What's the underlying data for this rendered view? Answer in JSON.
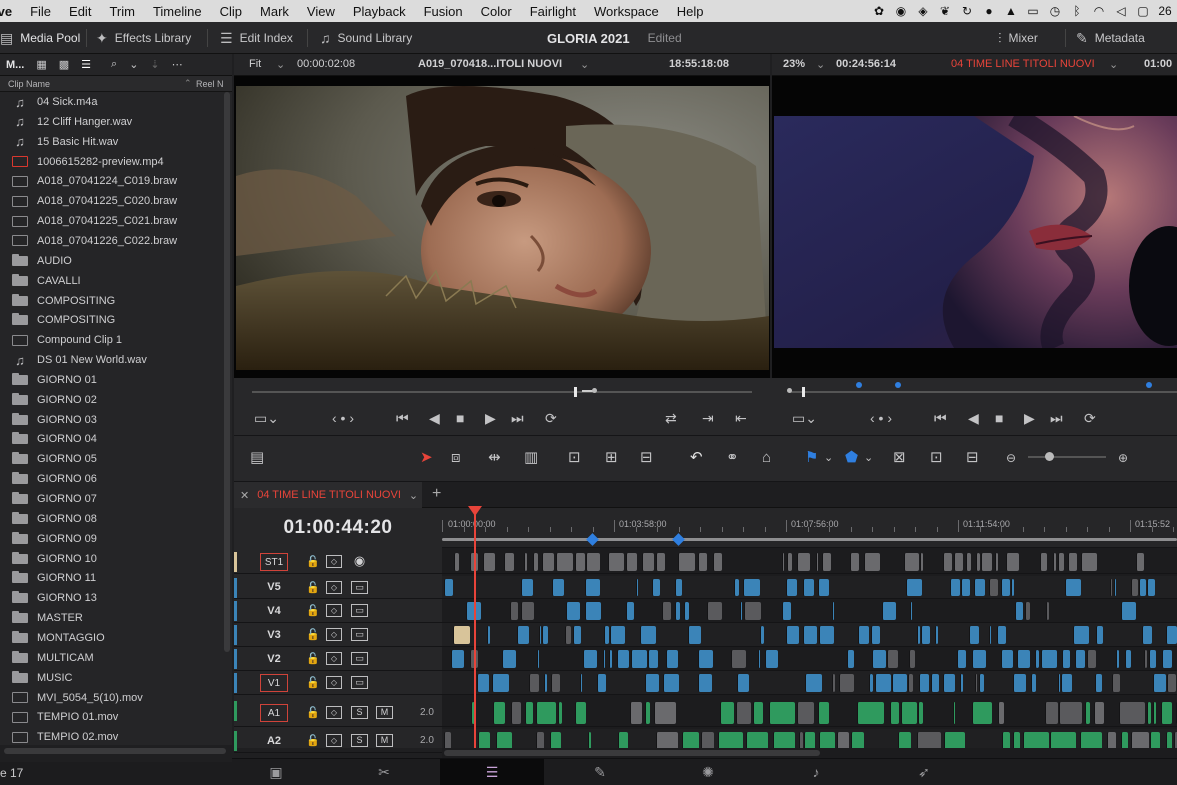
{
  "menubar": {
    "app": "ive",
    "items": [
      "File",
      "Edit",
      "Trim",
      "Timeline",
      "Clip",
      "Mark",
      "View",
      "Playback",
      "Fusion",
      "Color",
      "Fairlight",
      "Workspace",
      "Help"
    ],
    "clock": "26"
  },
  "toolbar": {
    "media_pool": "Media Pool",
    "effects_library": "Effects Library",
    "edit_index": "Edit Index",
    "sound_library": "Sound Library",
    "project_name": "GLORIA 2021",
    "project_status": "Edited",
    "mixer": "Mixer",
    "metadata": "Metadata"
  },
  "media_pool": {
    "view_label": "M...",
    "col_clip_name": "Clip Name",
    "col_reel_name": "Reel N",
    "items": [
      {
        "name": "04 Sick.m4a",
        "type": "audio"
      },
      {
        "name": "12 Cliff Hanger.wav",
        "type": "audio"
      },
      {
        "name": "15 Basic Hit.wav",
        "type": "audio"
      },
      {
        "name": "1006615282-preview.mp4",
        "type": "clip-red"
      },
      {
        "name": "A018_07041224_C019.braw",
        "type": "clip"
      },
      {
        "name": "A018_07041225_C020.braw",
        "type": "clip"
      },
      {
        "name": "A018_07041225_C021.braw",
        "type": "clip"
      },
      {
        "name": "A018_07041226_C022.braw",
        "type": "clip"
      },
      {
        "name": "AUDIO",
        "type": "folder"
      },
      {
        "name": "CAVALLI",
        "type": "folder"
      },
      {
        "name": "COMPOSITING",
        "type": "folder"
      },
      {
        "name": "COMPOSITING",
        "type": "folder"
      },
      {
        "name": "Compound Clip 1",
        "type": "clip"
      },
      {
        "name": "DS 01 New World.wav",
        "type": "audio"
      },
      {
        "name": "GIORNO 01",
        "type": "folder"
      },
      {
        "name": "GIORNO 02",
        "type": "folder"
      },
      {
        "name": "GIORNO 03",
        "type": "folder"
      },
      {
        "name": "GIORNO 04",
        "type": "folder"
      },
      {
        "name": "GIORNO 05",
        "type": "folder"
      },
      {
        "name": "GIORNO 06",
        "type": "folder"
      },
      {
        "name": "GIORNO 07",
        "type": "folder"
      },
      {
        "name": "GIORNO 08",
        "type": "folder"
      },
      {
        "name": "GIORNO 09",
        "type": "folder"
      },
      {
        "name": "GIORNO 10",
        "type": "folder"
      },
      {
        "name": "GIORNO 11",
        "type": "folder"
      },
      {
        "name": "GIORNO 13",
        "type": "folder"
      },
      {
        "name": "MASTER",
        "type": "folder"
      },
      {
        "name": "MONTAGGIO",
        "type": "folder"
      },
      {
        "name": "MULTICAM",
        "type": "folder"
      },
      {
        "name": "MUSIC",
        "type": "folder"
      },
      {
        "name": "MVI_5054_5(10).mov",
        "type": "clip"
      },
      {
        "name": "TEMPIO 01.mov",
        "type": "clip"
      },
      {
        "name": "TEMPIO 02.mov",
        "type": "clip"
      }
    ],
    "footer": "e 17"
  },
  "source_viewer": {
    "zoom": "Fit",
    "duration": "00:00:02:08",
    "clip_name": "A019_070418...ITOLI NUOVI",
    "timecode": "18:55:18:08"
  },
  "timeline_viewer": {
    "zoom": "23%",
    "duration": "00:24:56:14",
    "timeline_name": "04 TIME LINE TITOLI NUOVI",
    "timecode": "01:00"
  },
  "timeline": {
    "tab": "04 TIME LINE TITOLI NUOVI",
    "timecode": "01:00:44:20",
    "ruler": [
      "01:00:00:00",
      "01:03:58:00",
      "01:07:56:00",
      "01:11:54:00",
      "01:15:52"
    ],
    "tracks": [
      {
        "name": "ST1",
        "boxed": true,
        "kind": "subtitle"
      },
      {
        "name": "V5",
        "boxed": false,
        "kind": "video"
      },
      {
        "name": "V4",
        "boxed": false,
        "kind": "video"
      },
      {
        "name": "V3",
        "boxed": false,
        "kind": "video"
      },
      {
        "name": "V2",
        "boxed": false,
        "kind": "video"
      },
      {
        "name": "V1",
        "boxed": true,
        "kind": "video"
      },
      {
        "name": "A1",
        "boxed": true,
        "kind": "audio",
        "gain": "2.0"
      },
      {
        "name": "A2",
        "boxed": false,
        "kind": "audio",
        "gain": "2.0"
      }
    ],
    "solo_label": "S",
    "mute_label": "M"
  },
  "pages": [
    {
      "name": "media-icon",
      "glyph": "▣"
    },
    {
      "name": "cut-icon",
      "glyph": "✂"
    },
    {
      "name": "edit-icon",
      "glyph": "☰",
      "active": true
    },
    {
      "name": "fusion-icon",
      "glyph": "✎"
    },
    {
      "name": "color-icon",
      "glyph": "✺"
    },
    {
      "name": "fairlight-icon",
      "glyph": "♪"
    },
    {
      "name": "deliver-icon",
      "glyph": "➶"
    }
  ],
  "colors": {
    "accent_red": "#e8443a",
    "clip_blue": "#3b84b8",
    "clip_green": "#2f9a5e",
    "clip_gray": "#5a5a5d"
  }
}
